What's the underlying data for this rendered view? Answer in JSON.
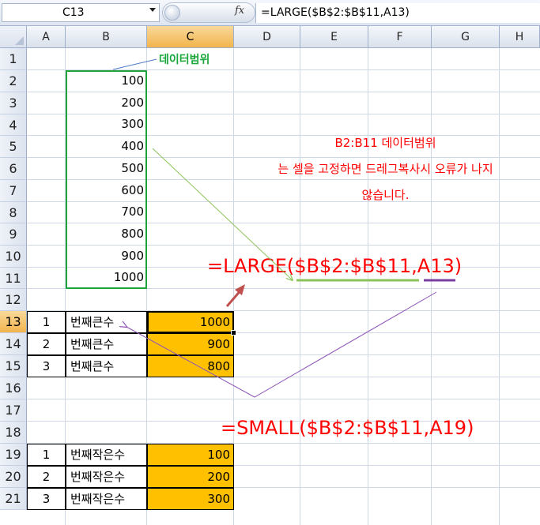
{
  "formula_bar": {
    "name_box": "C13",
    "fx_label": "fx",
    "formula": "=LARGE($B$2:$B$11,A13)"
  },
  "columns": [
    "A",
    "B",
    "C",
    "D",
    "E",
    "F",
    "G",
    "H"
  ],
  "rows": [
    "1",
    "2",
    "3",
    "4",
    "5",
    "6",
    "7",
    "8",
    "9",
    "10",
    "11",
    "12",
    "13",
    "14",
    "15",
    "16",
    "17",
    "18",
    "19",
    "20",
    "21"
  ],
  "data_values": [
    "100",
    "200",
    "300",
    "400",
    "500",
    "600",
    "700",
    "800",
    "900",
    "1000"
  ],
  "large_table": [
    {
      "rank": "1",
      "label": "번째큰수",
      "result": "1000"
    },
    {
      "rank": "2",
      "label": "번째큰수",
      "result": "900"
    },
    {
      "rank": "3",
      "label": "번째큰수",
      "result": "800"
    }
  ],
  "small_table": [
    {
      "rank": "1",
      "label": "번째작은수",
      "result": "100"
    },
    {
      "rank": "2",
      "label": "번째작은수",
      "result": "200"
    },
    {
      "rank": "3",
      "label": "번째작은수",
      "result": "300"
    }
  ],
  "annotations": {
    "range_label": "데이터범위",
    "note_line1": "B2:B11 데이터범위",
    "note_line2": "는 셀을 고정하면 드레그복사시 오류가 나지",
    "note_line3": "않습니다.",
    "large_formula": "=LARGE($B$2:$B$11,A13)",
    "small_formula": "=SMALL($B$2:$B$11,A19)"
  },
  "colors": {
    "result_fill": "#ffc000",
    "range_border": "#21a33b",
    "note_text": "#ff0000"
  }
}
